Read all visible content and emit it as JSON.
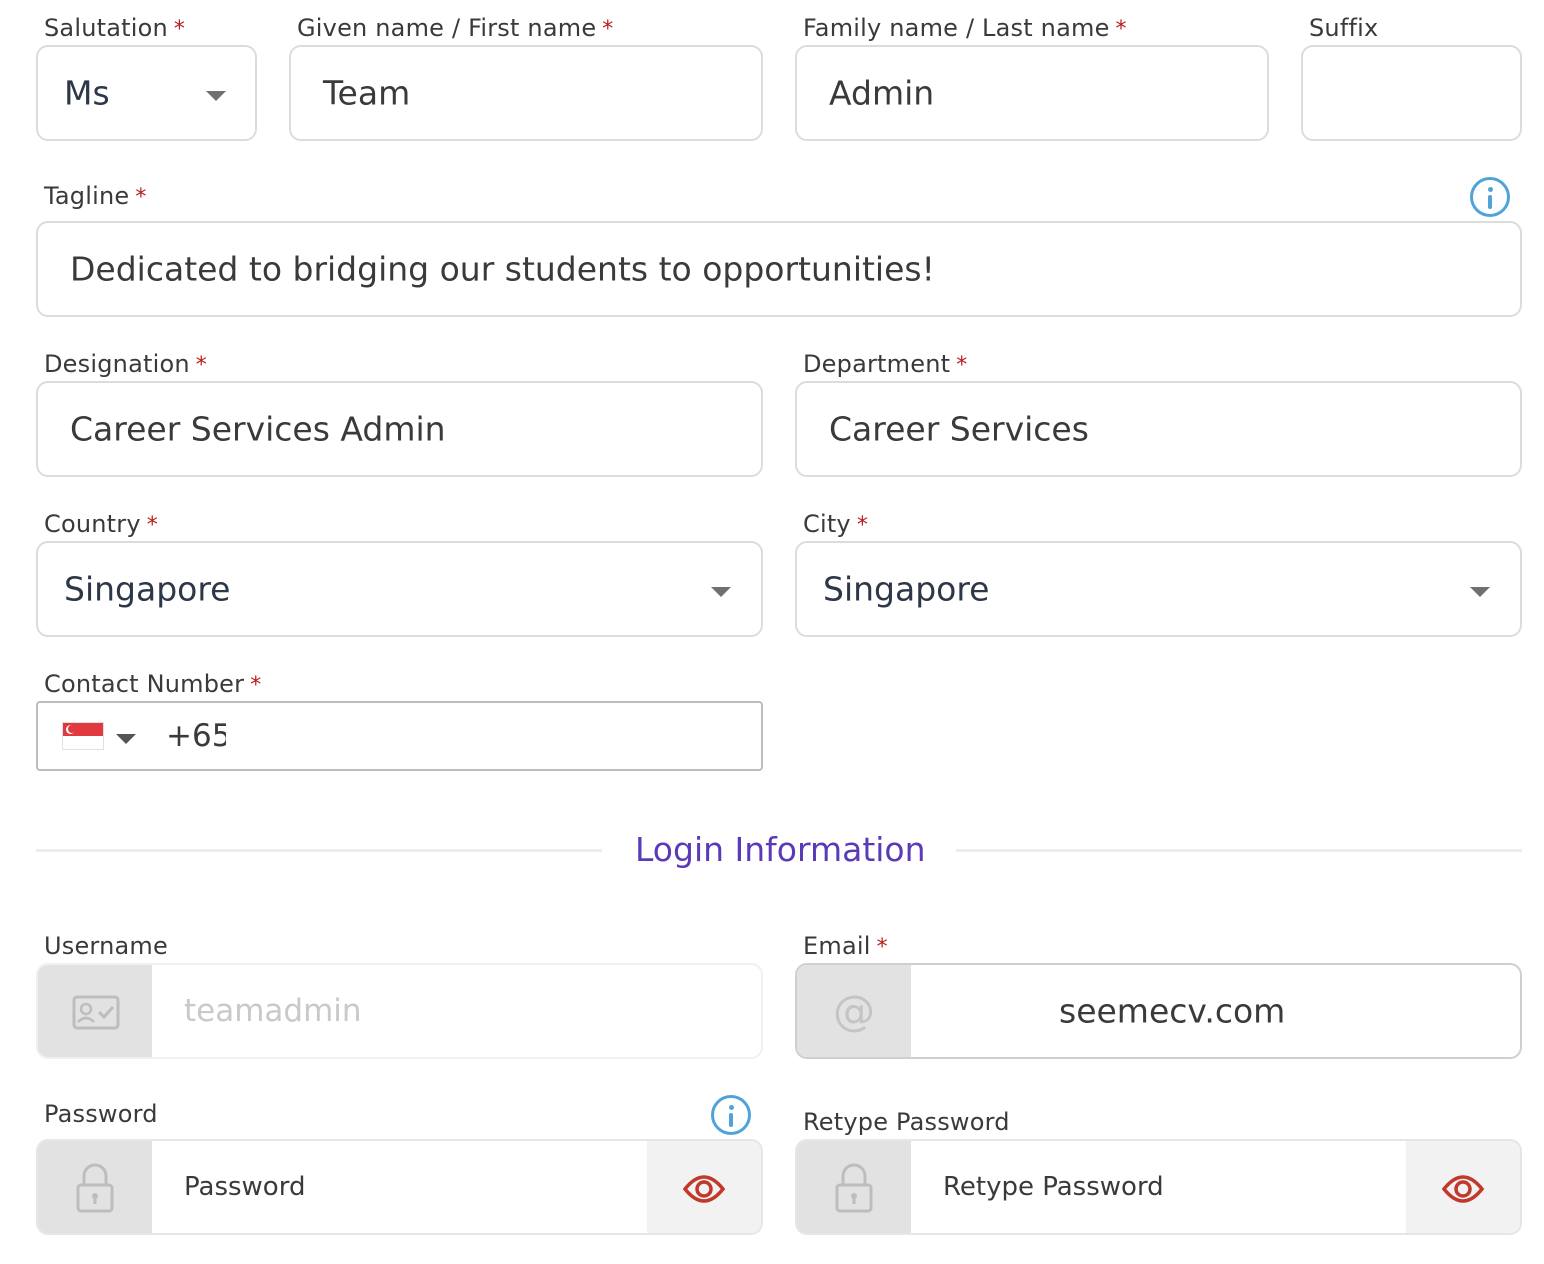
{
  "salutation": {
    "label": "Salutation",
    "value": "Ms"
  },
  "given_name": {
    "label": "Given name / First name",
    "value": "Team"
  },
  "family_name": {
    "label": "Family name / Last name",
    "value": "Admin"
  },
  "suffix": {
    "label": "Suffix",
    "value": ""
  },
  "tagline": {
    "label": "Tagline",
    "value": "Dedicated to bridging our students to opportunities!"
  },
  "designation": {
    "label": "Designation",
    "value": "Career Services Admin"
  },
  "department": {
    "label": "Department",
    "value": "Career Services"
  },
  "country": {
    "label": "Country",
    "value": "Singapore"
  },
  "city": {
    "label": "City",
    "value": "Singapore"
  },
  "contact": {
    "label": "Contact Number",
    "value": "+65",
    "flag": "singapore-flag"
  },
  "required_mark": "*",
  "section": {
    "title": "Login Information"
  },
  "username": {
    "label": "Username",
    "value": "teamadmin",
    "icon": "id-card-icon"
  },
  "email": {
    "label": "Email",
    "value": "seemecv.com",
    "icon": "at-icon"
  },
  "password": {
    "label": "Password",
    "placeholder": "Password",
    "icon": "lock-icon"
  },
  "retype_password": {
    "label": "Retype Password",
    "placeholder": "Retype Password",
    "icon": "lock-icon"
  },
  "colors": {
    "required": "#b71c1c",
    "accent": "#5b3ab8",
    "info": "#4fa3d8",
    "eye": "#c0392b"
  }
}
